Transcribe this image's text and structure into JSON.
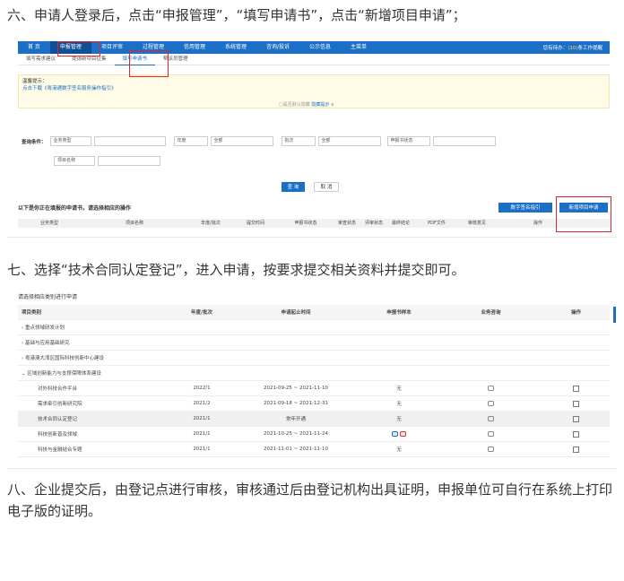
{
  "steps": {
    "six": "六、申请人登录后，点击“申报管理”，“填写申请书”，点击“新增项目申请”；",
    "seven": "七、选择“技术合同认定登记”，进入申请，按要求提交相关资料并提交即可。",
    "eight": "八、企业提交后，由登记点进行审核，审核通过后由登记机构出具证明，申报单位可自行在系统上打印电子版的证明。"
  },
  "shot1": {
    "topnav": [
      "首 页",
      "申报管理",
      "项目评审",
      "过程管理",
      "信用管理",
      "系统管理",
      "咨询/投诉",
      "公示信息",
      "主菜单"
    ],
    "topnav_right_prefix": "您有待办：",
    "topnav_right_count": "(10)",
    "topnav_right_suffix": "条工作提醒",
    "subnav": [
      "填写需求建议",
      "提请新项目征集",
      "填写申请书",
      "帮派员管理"
    ],
    "notice_title": "温馨提示：",
    "notice_line": "点击下载《粤港通数字签名服务操作指引》",
    "notice_center_a": "□是否默认隐藏 ",
    "notice_center_b": "隐藏提示 ∨",
    "filters": {
      "label": "查询条件：",
      "biz_type": "业务类型",
      "year": "年度",
      "all1": "全部",
      "batch": "批次",
      "all2": "全部",
      "status": "申报书状态",
      "project_name": "项目名称"
    },
    "query_btn": "查 询",
    "reset_btn": "取 消",
    "list_title": "以下是你正在填报的申请书，请选择相应的操作",
    "sign_btn": "数字签名指引",
    "new_btn": "新增项目申请",
    "table_headers": [
      "业务类型",
      "项目名称",
      "年度/批次",
      "提交时间",
      "申报书状态",
      "审查状态",
      "评审状态",
      "最终结论",
      "PDF文件",
      "审核意见",
      "操作"
    ]
  },
  "shot2": {
    "title": "请选择相应类别进行申请",
    "headers": [
      "项目类别",
      "年度/批次",
      "申请起止时间",
      "申报书样本",
      "业务咨询",
      "操作"
    ],
    "categories": [
      "重点领域研发计划",
      "基础与应用基础研究",
      "粤港澳大湾区国际科技创新中心建设",
      "区域创新能力与支撑保障体系建设"
    ],
    "rows": [
      {
        "name": "对外科技合作平台",
        "batch": "2022/1",
        "period": "2021-09-25 ~ 2021-11-10",
        "sample": "无"
      },
      {
        "name": "需求牵引创新研究院",
        "batch": "2021/2",
        "period": "2021-09-18 ~ 2021-12-31",
        "sample": "无"
      },
      {
        "name": "技术合同认定登记",
        "batch": "2021/1",
        "period": "常年开通",
        "sample": "无"
      },
      {
        "name": "科技创新普及领域",
        "batch": "2021/1",
        "period": "2021-10-25 ~ 2021-11-24",
        "sample": ""
      },
      {
        "name": "科技与金融结合专题",
        "batch": "2021/1",
        "period": "2021-11-01 ~ 2021-11-10",
        "sample": "无"
      }
    ]
  }
}
